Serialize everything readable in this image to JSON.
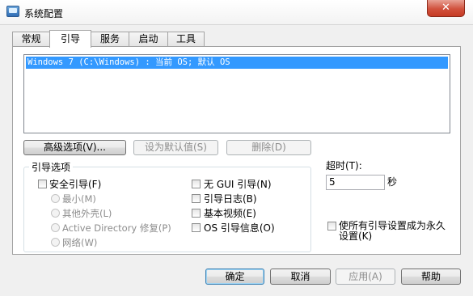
{
  "window": {
    "title": "系统配置",
    "close_glyph": "✕"
  },
  "tabs": [
    "常规",
    "引导",
    "服务",
    "启动",
    "工具"
  ],
  "boot_list": {
    "entries": [
      "Windows 7 (C:\\Windows) : 当前 OS; 默认 OS"
    ]
  },
  "list_buttons": {
    "advanced": "高级选项(V)...",
    "set_default": "设为默认值(S)",
    "delete": "删除(D)"
  },
  "boot_options": {
    "title": "引导选项",
    "safe_boot": {
      "label": "安全引导(F)",
      "checked": false
    },
    "radios": [
      "最小(M)",
      "其他外壳(L)",
      "Active Directory 修复(P)",
      "网络(W)"
    ],
    "checkboxes": [
      "无 GUI 引导(N)",
      "引导日志(B)",
      "基本视频(E)",
      "OS 引导信息(O)"
    ]
  },
  "timeout": {
    "label": "超时(T):",
    "value": "5",
    "unit": "秒"
  },
  "make_permanent": {
    "line1": "使所有引导设置成为永久",
    "line2": "设置(K)"
  },
  "footer_buttons": {
    "ok": "确定",
    "cancel": "取消",
    "apply": "应用(A)",
    "help": "帮助"
  }
}
